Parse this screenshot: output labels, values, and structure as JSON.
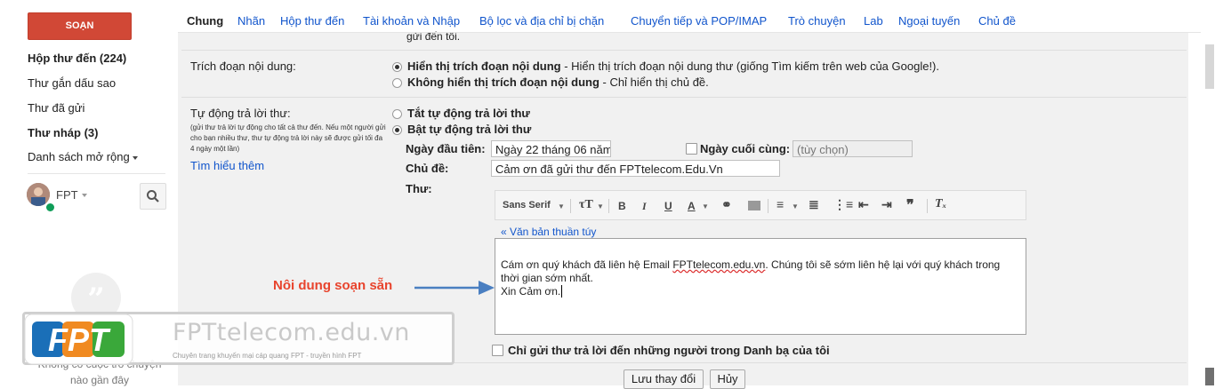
{
  "nav": {
    "compose": "SOẠN",
    "inbox": "Hộp thư đến (224)",
    "starred": "Thư gắn dấu sao",
    "sent": "Thư đã gửi",
    "drafts": "Thư nháp (3)",
    "more": "Danh sách mở rộng",
    "user": "FPT",
    "chat_empty_line1": "Không có cuộc trò chuyện",
    "chat_empty_line2": "nào gần đây"
  },
  "tabs": [
    "Chung",
    "Nhãn",
    "Hộp thư đến",
    "Tài khoản và Nhập",
    "Bộ lọc và địa chỉ bị chặn",
    "Chuyển tiếp và POP/IMAP",
    "Trò chuyện",
    "Lab",
    "Ngoại tuyến",
    "Chủ đề"
  ],
  "fragment_top": "gửi đến tôi.",
  "snippets": {
    "label": "Trích đoạn nội dung:",
    "opt1_bold": "Hiển thị trích đoạn nội dung",
    "opt1_rest": " - Hiển thị trích đoạn nội dung thư (giống Tìm kiếm trên web của Google!).",
    "opt2_bold": "Không hiển thị trích đoạn nội dung",
    "opt2_rest": " - Chỉ hiển thị chủ đề."
  },
  "vacation": {
    "label": "Tự động trả lời thư:",
    "hint": "(gửi thư trả lời tự động cho tất cả thư đến. Nếu một người gửi cho bạn nhiều thư, thư tự động trả lời này sẽ được gửi tối đa 4 ngày một lần)",
    "learn_more": "Tìm hiểu thêm",
    "off": "Tắt tự động trả lời thư",
    "on": "Bật tự động trả lời thư",
    "first_day_label": "Ngày đầu tiên:",
    "first_day_value": "Ngày 22 tháng 06 năm",
    "last_day_label": "Ngày cuối cùng:",
    "last_day_placeholder": "(tùy chọn)",
    "subject_label": "Chủ đề:",
    "subject_value": "Cảm ơn đã gửi thư đến FPTtelecom.Edu.Vn",
    "message_label": "Thư:",
    "font_name": "Sans Serif",
    "plain_text_link": "« Văn bản thuần túy",
    "body_pre": "Cám ơn quý khách đã liên hệ Email ",
    "body_link": "FPTtelecom.edu.vn",
    "body_post": ". Chúng tôi sẽ sớm liên hệ lại với quý khách trong thời gian sớm nhất.",
    "body_line2": "Xin Cảm ơn.",
    "contacts_only": "Chỉ gửi thư trả lời đến những người trong Danh bạ của tôi"
  },
  "buttons": {
    "save": "Lưu thay đổi",
    "cancel": "Hủy"
  },
  "annotation": "Nôi dung soạn sẵn",
  "watermark": {
    "logo": "FPT",
    "title": "FPTtelecom.edu.vn",
    "subtitle": "Chuyên trang khuyến mại cáp quang FPT - truyền hình FPT"
  },
  "colors": {
    "compose": "#d14836",
    "link": "#1155cc",
    "annotation": "#e8442d",
    "arrow": "#4a7fc1"
  }
}
